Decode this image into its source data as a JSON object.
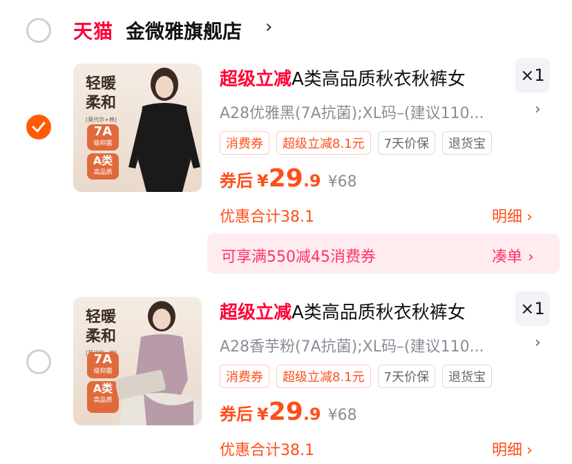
{
  "store": {
    "platform_logo": "天猫",
    "name": "金微雅旗舰店",
    "chevron": "›"
  },
  "products": [
    {
      "selected": true,
      "thumb": {
        "line1": "轻暖",
        "line2": "柔和",
        "small": "[莫代尔+棉]",
        "chip1_big": "7A",
        "chip1_small": "级抑菌",
        "chip2_big": "A类",
        "chip2_small": "高品质",
        "garment_color": "#1a1a1a"
      },
      "promo_prefix": "超级立减",
      "title": "A类高品质秋衣秋裤女",
      "quantity": "×1",
      "sku": "A28优雅黑(7A抗菌);XL码–(建议110...",
      "tags": [
        "消费券",
        "超级立减8.1元",
        "7天价保",
        "退货宝"
      ],
      "price_label": "券后",
      "currency": "¥",
      "price_int": "29",
      "price_dec": ".9",
      "original_price": "¥68",
      "discount_total": "优惠合计38.1",
      "detail_label": "明细",
      "coupon": {
        "text": "可享满550减45消费券",
        "action": "凑单"
      }
    },
    {
      "selected": false,
      "thumb": {
        "line1": "轻暖",
        "line2": "柔和",
        "small": "[莫代尔+棉]",
        "chip1_big": "7A",
        "chip1_small": "级抑菌",
        "chip2_big": "A类",
        "chip2_small": "高品质",
        "garment_color": "#b89aa8"
      },
      "promo_prefix": "超级立减",
      "title": "A类高品质秋衣秋裤女",
      "quantity": "×1",
      "sku": "A28香芋粉(7A抗菌);XL码–(建议110...",
      "tags": [
        "消费券",
        "超级立减8.1元",
        "7天价保",
        "退货宝"
      ],
      "price_label": "券后",
      "currency": "¥",
      "price_int": "29",
      "price_dec": ".9",
      "original_price": "¥68",
      "discount_total": "优惠合计38.1",
      "detail_label": "明细"
    }
  ],
  "chevron": "›"
}
